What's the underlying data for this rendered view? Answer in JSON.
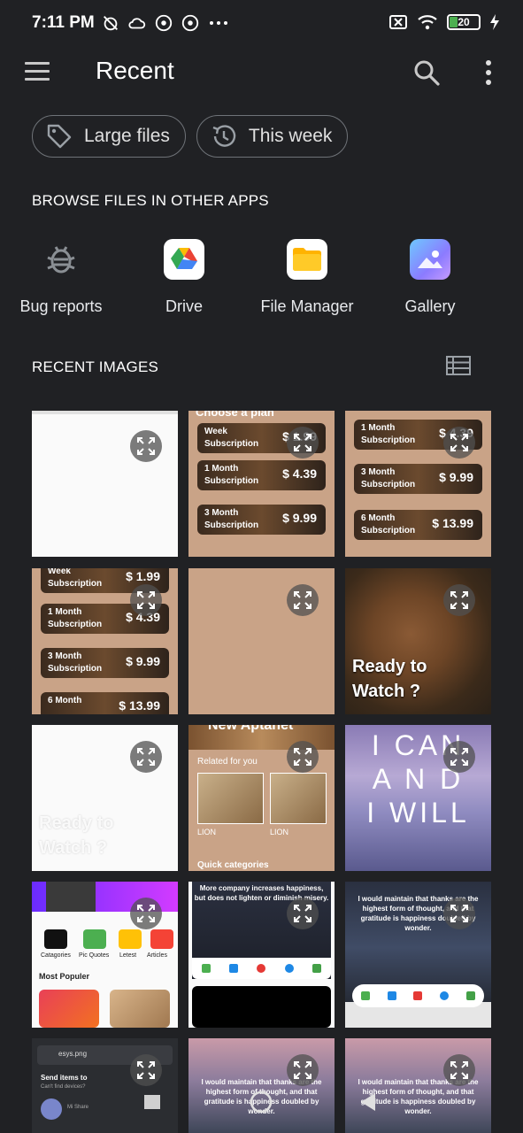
{
  "status_bar": {
    "time": "7:11 PM",
    "battery": "20"
  },
  "app_bar": {
    "title": "Recent"
  },
  "chips": [
    {
      "label": "Large files",
      "icon": "tag-icon"
    },
    {
      "label": "This week",
      "icon": "history-icon"
    }
  ],
  "browse_section": {
    "title": "BROWSE FILES IN OTHER APPS",
    "apps": [
      {
        "label": "Bug reports",
        "icon": "bug-icon"
      },
      {
        "label": "Drive",
        "icon": "drive-icon"
      },
      {
        "label": "File Manager",
        "icon": "folder-icon"
      },
      {
        "label": "Gallery",
        "icon": "gallery-icon"
      }
    ]
  },
  "recent_images": {
    "title": "RECENT IMAGES",
    "tiles": {
      "t2": {
        "header": "Choose a plan",
        "cards": [
          {
            "name": "Week",
            "sub": "Subscription",
            "price": "$ 1.99"
          },
          {
            "name": "1 Month",
            "sub": "Subscription",
            "price": "$ 4.39"
          },
          {
            "name": "3 Month",
            "sub": "Subscription",
            "price": "$ 9.99"
          }
        ]
      },
      "t3": {
        "cards": [
          {
            "name": "1 Month",
            "sub": "Subscription",
            "price": "$ 4.39"
          },
          {
            "name": "3 Month",
            "sub": "Subscription",
            "price": "$ 9.99"
          },
          {
            "name": "6 Month",
            "sub": "Subscription",
            "price": "$ 13.99"
          }
        ]
      },
      "t4": {
        "cards": [
          {
            "name": "Week",
            "sub": "Subscription",
            "price": "$ 1.99"
          },
          {
            "name": "1 Month",
            "sub": "Subscription",
            "price": "$ 4.39"
          },
          {
            "name": "3 Month",
            "sub": "Subscription",
            "price": "$ 9.99"
          },
          {
            "name": "6 Month",
            "sub": "",
            "price": "$ 13.99"
          }
        ]
      },
      "t6": {
        "line1": "Ready to",
        "line2": "Watch ?"
      },
      "t7": {
        "line1": "Ready to",
        "line2": "Watch ?"
      },
      "t8": {
        "header": "New Aptanet",
        "related": "Related for you",
        "lion1": "LION",
        "lion2": "LION",
        "footer": "Quick categories"
      },
      "t9": {
        "line1": "I CAN",
        "line2": "A N D",
        "line3": "I WILL"
      },
      "t10": {
        "cat1": "Catagories",
        "cat2": "Pic Quotes",
        "cat3": "Letest",
        "cat4": "Articles",
        "most": "Most Populer"
      },
      "t11": {
        "quote": "More company increases happiness, but does not lighten or diminish misery."
      },
      "t12": {
        "quote": "I would maintain that thanks are the highest form of thought, and that gratitude is happiness doubled by wonder."
      },
      "t13": {
        "file": "esys.png",
        "send": "Send items to",
        "sub": "Can't find devices?",
        "device": "Mi Share"
      },
      "t14": {
        "quote": "I would maintain that thanks are the highest form of thought, and that gratitude is happiness doubled by wonder."
      },
      "t15": {
        "quote": "I would maintain that thanks are the highest form of thought, and that gratitude is happiness doubled by wonder."
      }
    }
  }
}
